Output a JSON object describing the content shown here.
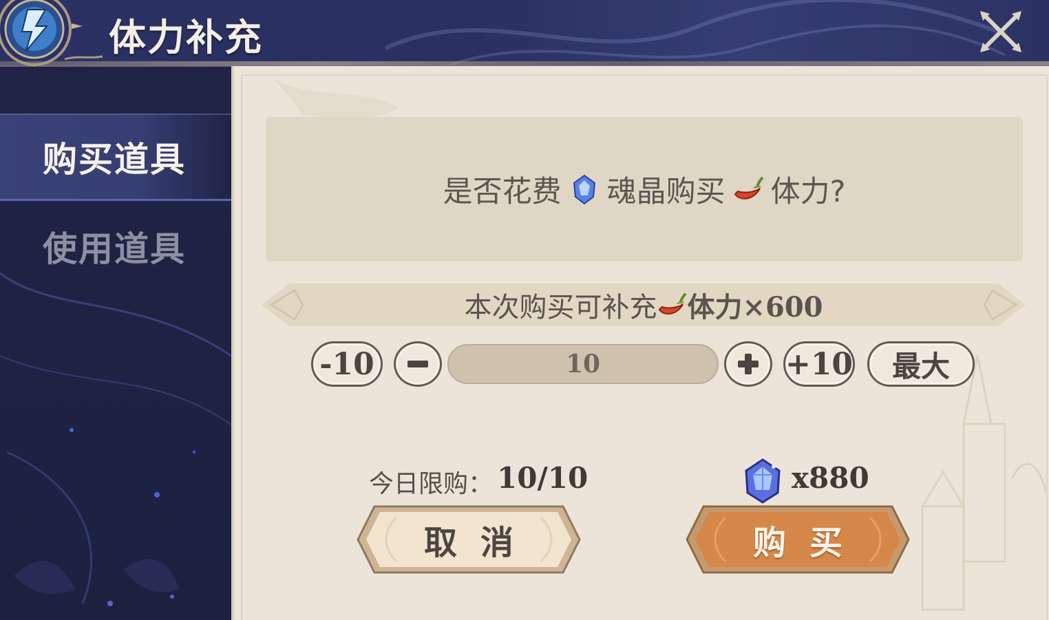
{
  "header": {
    "title": "体力补充"
  },
  "sidebar": {
    "items": [
      {
        "label": "购买道具",
        "active": true
      },
      {
        "label": "使用道具",
        "active": false
      }
    ]
  },
  "dialog": {
    "question": {
      "part1": "是否花费",
      "icon1": "soul-crystal-icon",
      "part2": "魂晶购买",
      "icon2": "stamina-pepper-icon",
      "part3": "体力?"
    },
    "ribbon": {
      "prefix": "本次购买可补充",
      "icon": "stamina-pepper-icon",
      "suffix": "体力×600"
    },
    "controls": {
      "minus10_label": "-10",
      "minus_label": "−",
      "quantity": "10",
      "plus_label": "+",
      "plus10_label": "+10",
      "max_label": "最大"
    },
    "daily_limit": {
      "label": "今日限购：",
      "value": "10/10"
    },
    "cost": {
      "icon": "soul-crystal-icon",
      "value": "x880"
    },
    "buttons": {
      "cancel_label": "取消",
      "buy_label": "购买"
    }
  },
  "colors": {
    "header_bg": "#2b3164",
    "sidebar_bg": "#1f2446",
    "panel_bg": "#ece4d8",
    "buy_button": "#d88a4c",
    "cancel_button": "#f0e4cf"
  }
}
